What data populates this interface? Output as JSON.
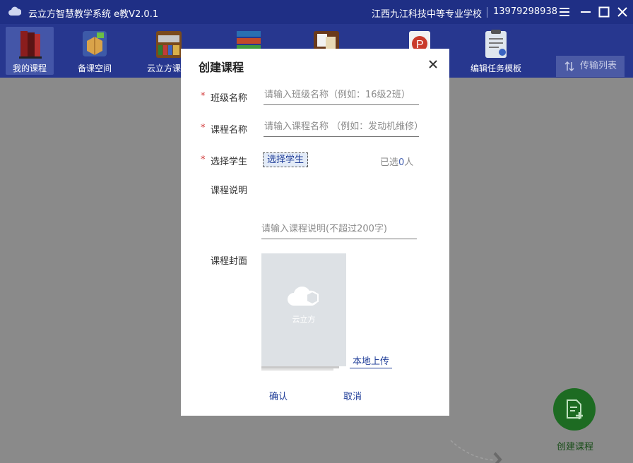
{
  "titlebar": {
    "app_title": "云立方智慧教学系统 e教V2.0.1",
    "school": "江西九江科技中等专业学校",
    "phone": "13979298938"
  },
  "toolbar": {
    "items": [
      {
        "label": "我的课程",
        "icon": "books-icon",
        "active": true
      },
      {
        "label": "备课空间",
        "icon": "open-box-icon"
      },
      {
        "label": "云立方课程",
        "icon": "archive-icon"
      },
      {
        "label": "",
        "icon": "doc-stack-icon"
      },
      {
        "label": "",
        "icon": "cards-icon"
      },
      {
        "label": "",
        "icon": "ppt-icon"
      },
      {
        "label": "编辑任务模板",
        "icon": "clipboard-icon"
      }
    ],
    "transfer_label": "传输列表"
  },
  "modal": {
    "title": "创建课程",
    "class_name": {
      "label": "班级名称",
      "placeholder": "请输入班级名称（例如：16级2班）"
    },
    "course_name": {
      "label": "课程名称",
      "placeholder": "请输入课程名称 （例如：发动机维修）"
    },
    "students": {
      "label": "选择学生",
      "button": "选择学生",
      "count_prefix": "已选",
      "count": "0",
      "count_suffix": "人"
    },
    "description": {
      "label": "课程说明",
      "placeholder": "请输入课程说明(不超过200字)"
    },
    "cover": {
      "label": "课程封面",
      "watermark": "云立方",
      "upload": "本地上传"
    },
    "confirm": "确认",
    "cancel": "取消"
  },
  "main": {
    "create_course_label": "创建课程"
  },
  "colors": {
    "titlebar": "#1f2f85",
    "toolbar": "#27378f",
    "accent_link": "#23409a",
    "required": "#d23b3b",
    "fab": "#1d6b22"
  }
}
